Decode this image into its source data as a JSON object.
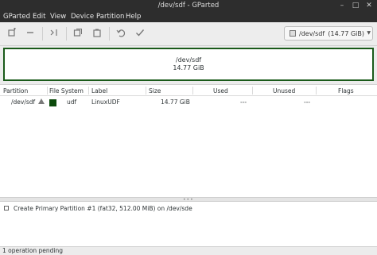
{
  "window": {
    "title": "/dev/sdf - GParted"
  },
  "menu": [
    "GParted",
    "Edit",
    "View",
    "Device",
    "Partition",
    "Help"
  ],
  "toolbar": {
    "icons": [
      "new-partition-icon",
      "delete-partition-icon",
      "resize-move-icon",
      "copy-icon",
      "paste-icon",
      "undo-icon",
      "apply-icon"
    ]
  },
  "device_selector": {
    "device": "/dev/sdf",
    "size": "(14.77 GiB)"
  },
  "disk_map": {
    "line1": "/dev/sdf",
    "line2": "14.77 GiB",
    "border_color": "#1a5a1a"
  },
  "table": {
    "headers": [
      "Partition",
      "File System",
      "Label",
      "Size",
      "Used",
      "Unused",
      "Flags"
    ],
    "rows": [
      {
        "partition": "/dev/sdf",
        "filesystem": "udf",
        "label": "LinuxUDF",
        "size": "14.77 GiB",
        "used": "---",
        "unused": "---",
        "flags": "",
        "fs_color": "#0b4a0b"
      }
    ]
  },
  "operations": [
    "Create Primary Partition #1 (fat32, 512.00 MiB) on /dev/sde"
  ],
  "status": "1 operation pending"
}
